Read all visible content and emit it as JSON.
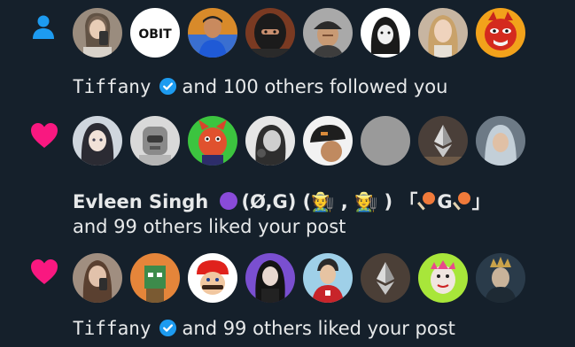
{
  "notifications": [
    {
      "type": "follow",
      "icon": "person-icon",
      "icon_color": "#1d9bf0",
      "avatars": [
        "avatar-woman-phone",
        "avatar-obit-logo",
        "avatar-man-blue",
        "avatar-balaclava",
        "avatar-man-cap",
        "avatar-hooded-figure",
        "avatar-blonde-woman",
        "avatar-red-mascot"
      ],
      "obit_text": "OBIT",
      "name": "Tiffany",
      "rest": "and 100 others followed you"
    },
    {
      "type": "like",
      "icon": "heart-icon",
      "icon_color": "#f91880",
      "avatars": [
        "avatar-anime-girl",
        "avatar-robot",
        "avatar-red-cartoon",
        "avatar-woman-bw",
        "avatar-cap-back",
        "avatar-gray-blank",
        "avatar-eth-logo",
        "avatar-hijab-woman"
      ],
      "name": "Evleen Singh",
      "name_extra": "(Ø,G) (🧑‍🌾 , 🧑‍🌾 ) 「",
      "name_extra_g": "G",
      "name_extra_end": "」",
      "rest": "and 99 others liked your post"
    },
    {
      "type": "like",
      "icon": "heart-icon",
      "icon_color": "#f91880",
      "avatars": [
        "avatar-woman-phone-2",
        "avatar-nft-character",
        "avatar-mario",
        "avatar-goth-woman",
        "avatar-man-red-shirt",
        "avatar-eth-logo-2",
        "avatar-nft-doodle",
        "avatar-crowned-figure"
      ],
      "name": "Tiffany",
      "rest": "and 99 others liked your post"
    }
  ],
  "colors": {
    "background": "#15202b",
    "text": "#e7e9ea",
    "verified": "#1d9bf0",
    "purple_circle": "#8a4bd9"
  }
}
